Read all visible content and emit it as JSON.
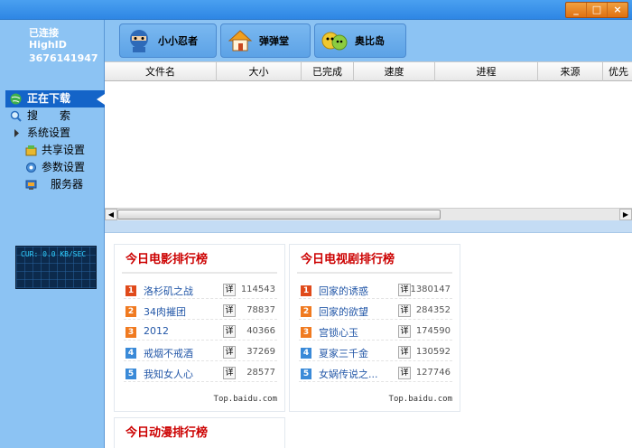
{
  "window": {
    "minimize": "_",
    "maximize": "□",
    "close": "×"
  },
  "status": {
    "connection": "已连接",
    "id_type": "HighID",
    "id_number": "3676141947"
  },
  "nav": [
    {
      "label": "正在下载",
      "icon": "globe-icon",
      "active": true
    },
    {
      "label": "搜　　索",
      "icon": "search-icon"
    },
    {
      "label": "系统设置",
      "icon": "expand-triangle-icon"
    },
    {
      "label": "共享设置",
      "icon": "share-icon"
    },
    {
      "label": "参数设置",
      "icon": "gear-icon"
    },
    {
      "label": "服务器",
      "icon": "server-icon"
    }
  ],
  "speed_meter": {
    "text": "CUR: 0.0 KB/SEC"
  },
  "toolbar": {
    "buttons": [
      {
        "label": "小小忍者",
        "icon": "ninja-icon"
      },
      {
        "label": "弹弹堂",
        "icon": "house-icon"
      },
      {
        "label": "奥比岛",
        "icon": "aobi-icon"
      }
    ]
  },
  "table": {
    "columns": [
      "文件名",
      "大小",
      "已完成",
      "速度",
      "进程",
      "来源",
      "优先"
    ]
  },
  "rankings": [
    {
      "title": "今日电影排行榜",
      "items": [
        {
          "rank": "1",
          "name": "洛杉矶之战",
          "detail": "详",
          "value": "114543"
        },
        {
          "rank": "2",
          "name": "34肉摧团",
          "detail": "详",
          "value": "78837"
        },
        {
          "rank": "3",
          "name": "2012",
          "detail": "详",
          "value": "40366"
        },
        {
          "rank": "4",
          "name": "戒烟不戒酒",
          "detail": "详",
          "value": "37269"
        },
        {
          "rank": "5",
          "name": "我知女人心",
          "detail": "详",
          "value": "28577"
        }
      ],
      "footer": "Top.baidu.com"
    },
    {
      "title": "今日电视剧排行榜",
      "items": [
        {
          "rank": "1",
          "name": "回家的诱惑",
          "detail": "详",
          "value": "1380147"
        },
        {
          "rank": "2",
          "name": "回家的欲望",
          "detail": "详",
          "value": "284352"
        },
        {
          "rank": "3",
          "name": "宫锁心玉",
          "detail": "详",
          "value": "174590"
        },
        {
          "rank": "4",
          "name": "夏家三千金",
          "detail": "详",
          "value": "130592"
        },
        {
          "rank": "5",
          "name": "女娲传说之...",
          "detail": "详",
          "value": "127746"
        }
      ],
      "footer": "Top.baidu.com"
    },
    {
      "title": "今日动漫排行榜"
    }
  ],
  "colors": {
    "rank_top": "#e04a1a",
    "rank_mid": "#f07a20",
    "rank_low": "#3a8ad8",
    "title_red": "#cc0000",
    "nav_active": "#1464c8"
  }
}
